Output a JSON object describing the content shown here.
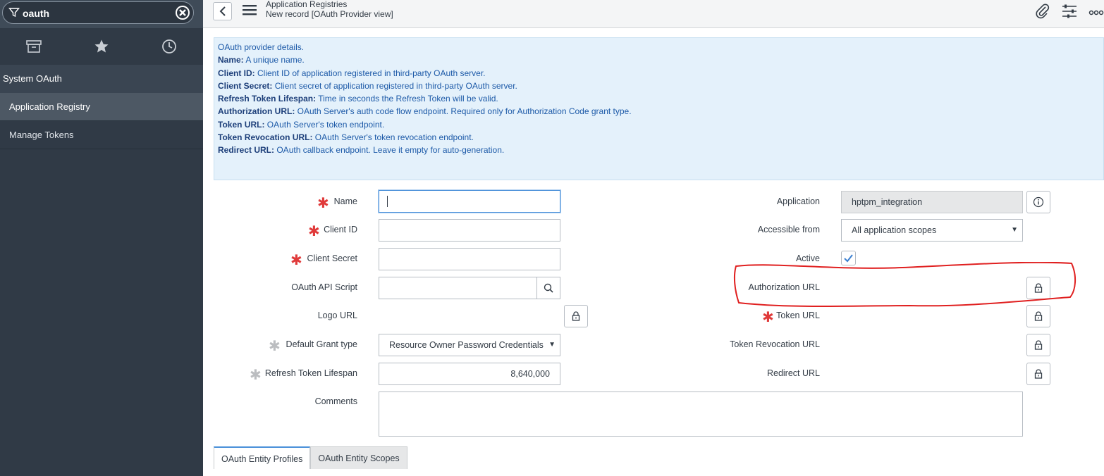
{
  "sidebar": {
    "filter_value": "oauth",
    "section_header": "System OAuth",
    "items": [
      {
        "label": "Application Registry",
        "active": true
      },
      {
        "label": "Manage Tokens",
        "active": false
      }
    ],
    "nav_icons": [
      "archive-icon",
      "star-icon",
      "clock-icon"
    ]
  },
  "header": {
    "title": "Application Registries",
    "subtitle": "New record [OAuth Provider view]",
    "icons": [
      "paperclip-icon",
      "sliders-icon",
      "more-icon"
    ]
  },
  "info": {
    "intro": "OAuth provider details.",
    "lines": [
      {
        "key": "Name:",
        "text": " A unique name."
      },
      {
        "key": "Client ID:",
        "text": " Client ID of application registered in third-party OAuth server."
      },
      {
        "key": "Client Secret:",
        "text": " Client secret of application registered in third-party OAuth server."
      },
      {
        "key": "Refresh Token Lifespan:",
        "text": " Time in seconds the Refresh Token will be valid."
      },
      {
        "key": "Authorization URL:",
        "text": " OAuth Server's auth code flow endpoint. Required only for Authorization Code grant type."
      },
      {
        "key": "Token URL:",
        "text": " OAuth Server's token endpoint."
      },
      {
        "key": "Token Revocation URL:",
        "text": " OAuth Server's token revocation endpoint."
      },
      {
        "key": "Redirect URL:",
        "text": " OAuth callback endpoint. Leave it empty for auto-generation."
      }
    ]
  },
  "form": {
    "left": {
      "name_label": "Name",
      "name_value": "",
      "client_id_label": "Client ID",
      "client_secret_label": "Client Secret",
      "api_script_label": "OAuth API Script",
      "logo_url_label": "Logo URL",
      "grant_type_label": "Default Grant type",
      "grant_type_value": "Resource Owner Password Credentials",
      "refresh_label": "Refresh Token Lifespan",
      "refresh_value": "8,640,000",
      "comments_label": "Comments"
    },
    "right": {
      "application_label": "Application",
      "application_value": "hptpm_integration",
      "accessible_label": "Accessible from",
      "accessible_value": "All application scopes",
      "active_label": "Active",
      "active_checked": true,
      "auth_url_label": "Authorization URL",
      "token_url_label": "Token URL",
      "revocation_label": "Token Revocation URL",
      "redirect_label": "Redirect URL"
    }
  },
  "tabs": [
    {
      "label": "OAuth Entity Profiles",
      "active": true
    },
    {
      "label": "OAuth Entity Scopes",
      "active": false
    }
  ],
  "colors": {
    "sidebar_bg": "#303a46",
    "accent": "#4a90d9",
    "required": "#e03a3a",
    "info_bg": "#e4f1fb",
    "annotation": "#e02020"
  }
}
